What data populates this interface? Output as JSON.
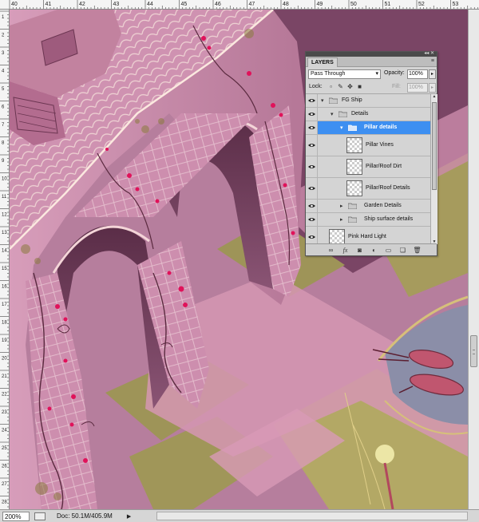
{
  "rulers": {
    "top_labels": [
      "40",
      "41",
      "42",
      "43",
      "44",
      "45",
      "46",
      "47",
      "48",
      "49",
      "50",
      "51",
      "52",
      "53"
    ],
    "left_labels": [
      "1",
      "2",
      "3",
      "4",
      "5",
      "6",
      "7",
      "8",
      "9",
      "10",
      "11",
      "12",
      "13",
      "14",
      "15",
      "16",
      "17",
      "18",
      "19",
      "20",
      "21",
      "22",
      "23",
      "24",
      "25",
      "26",
      "27",
      "28"
    ]
  },
  "layers_panel": {
    "tab_label": "LAYERS",
    "blend_mode": "Pass Through",
    "opacity_label": "Opacity:",
    "opacity_value": "100%",
    "lock_label": "Lock:",
    "fill_label": "Fill:",
    "fill_value": "100%",
    "layers": [
      {
        "name": "FG Ship",
        "kind": "group",
        "expanded": true,
        "visible": true,
        "selected": false
      },
      {
        "name": "Details",
        "kind": "group",
        "expanded": true,
        "visible": true,
        "selected": false
      },
      {
        "name": "Pillar details",
        "kind": "group",
        "expanded": true,
        "visible": true,
        "selected": true
      },
      {
        "name": "Pillar Vines",
        "kind": "layer",
        "visible": true,
        "selected": false
      },
      {
        "name": "Pillar/Roof Dirt",
        "kind": "layer",
        "visible": true,
        "selected": false
      },
      {
        "name": "Pillar/Roof Details",
        "kind": "layer",
        "visible": true,
        "selected": false
      },
      {
        "name": "Garden Details",
        "kind": "group",
        "expanded": false,
        "visible": true,
        "selected": false
      },
      {
        "name": "Ship surface details",
        "kind": "group",
        "expanded": false,
        "visible": true,
        "selected": false
      },
      {
        "name": "Pink Hard Light",
        "kind": "layer",
        "visible": true,
        "selected": false
      }
    ],
    "footer_icons": [
      "link-icon",
      "fx-icon",
      "mask-icon",
      "adjustment-icon",
      "new-group-icon",
      "new-layer-icon",
      "trash-icon"
    ]
  },
  "status_bar": {
    "zoom": "200%",
    "doc_info": "Doc: 50.1M/405.9M",
    "arrow": "▶"
  },
  "colors": {
    "selection": "#3d8ff1",
    "panel_bg": "#d4d4d4",
    "canvas_pink": "#c48aa8",
    "canvas_olive": "#9a9256"
  }
}
